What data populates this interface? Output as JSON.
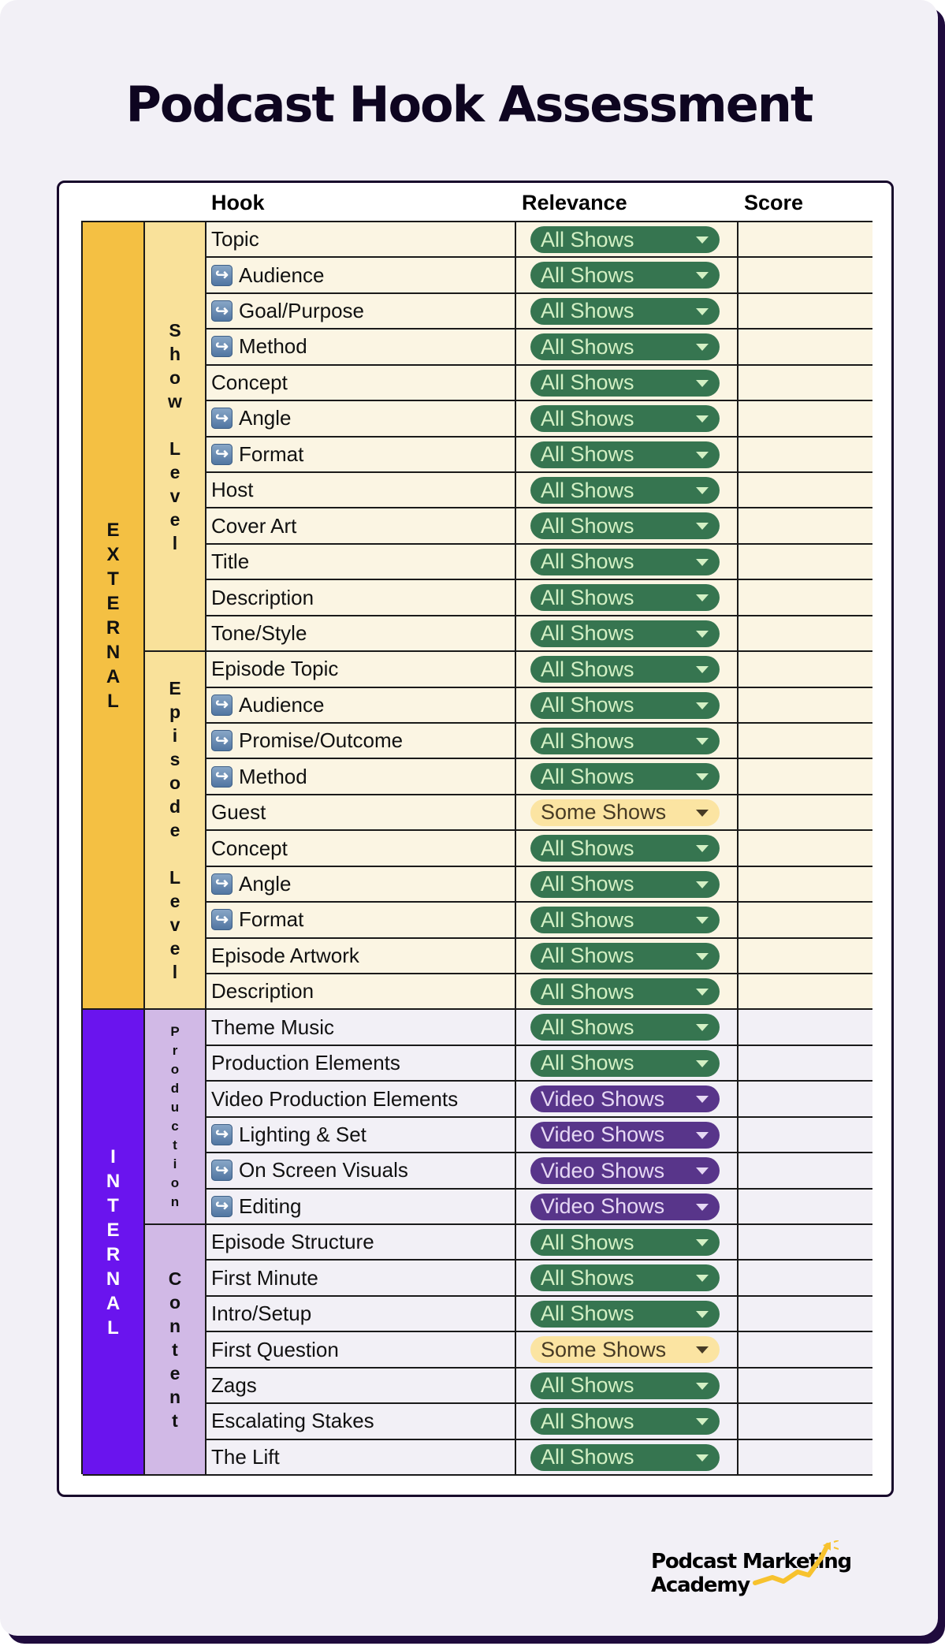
{
  "title": "Podcast Hook Assessment",
  "columns": {
    "hook": "Hook",
    "relevance": "Relevance",
    "score": "Score"
  },
  "relevance_colors": {
    "All Shows": "#367550",
    "Some Shows": "#fbe4a2",
    "Video Shows": "#58358a"
  },
  "groups": [
    {
      "label": "EXTERNAL",
      "color": "#f4c043",
      "subgroups": [
        {
          "label": "Show Level",
          "rows": [
            {
              "hook": "Topic",
              "sub": false,
              "relevance": "All Shows",
              "score": ""
            },
            {
              "hook": "Audience",
              "sub": true,
              "relevance": "All Shows",
              "score": ""
            },
            {
              "hook": "Goal/Purpose",
              "sub": true,
              "relevance": "All Shows",
              "score": ""
            },
            {
              "hook": "Method",
              "sub": true,
              "relevance": "All Shows",
              "score": ""
            },
            {
              "hook": "Concept",
              "sub": false,
              "relevance": "All Shows",
              "score": ""
            },
            {
              "hook": "Angle",
              "sub": true,
              "relevance": "All Shows",
              "score": ""
            },
            {
              "hook": "Format",
              "sub": true,
              "relevance": "All Shows",
              "score": ""
            },
            {
              "hook": "Host",
              "sub": false,
              "relevance": "All Shows",
              "score": ""
            },
            {
              "hook": "Cover Art",
              "sub": false,
              "relevance": "All Shows",
              "score": ""
            },
            {
              "hook": "Title",
              "sub": false,
              "relevance": "All Shows",
              "score": ""
            },
            {
              "hook": "Description",
              "sub": false,
              "relevance": "All Shows",
              "score": ""
            },
            {
              "hook": "Tone/Style",
              "sub": false,
              "relevance": "All Shows",
              "score": ""
            }
          ]
        },
        {
          "label": "Episode Level",
          "rows": [
            {
              "hook": "Episode Topic",
              "sub": false,
              "relevance": "All Shows",
              "score": ""
            },
            {
              "hook": "Audience",
              "sub": true,
              "relevance": "All Shows",
              "score": ""
            },
            {
              "hook": "Promise/Outcome",
              "sub": true,
              "relevance": "All Shows",
              "score": ""
            },
            {
              "hook": "Method",
              "sub": true,
              "relevance": "All Shows",
              "score": ""
            },
            {
              "hook": "Guest",
              "sub": false,
              "relevance": "Some Shows",
              "score": ""
            },
            {
              "hook": "Concept",
              "sub": false,
              "relevance": "All Shows",
              "score": ""
            },
            {
              "hook": "Angle",
              "sub": true,
              "relevance": "All Shows",
              "score": ""
            },
            {
              "hook": "Format",
              "sub": true,
              "relevance": "All Shows",
              "score": ""
            },
            {
              "hook": "Episode Artwork",
              "sub": false,
              "relevance": "All Shows",
              "score": ""
            },
            {
              "hook": "Description",
              "sub": false,
              "relevance": "All Shows",
              "score": ""
            }
          ]
        }
      ]
    },
    {
      "label": "INTERNAL",
      "color": "#6a14ee",
      "subgroups": [
        {
          "label": "Production",
          "rows": [
            {
              "hook": "Theme Music",
              "sub": false,
              "relevance": "All Shows",
              "score": ""
            },
            {
              "hook": "Production Elements",
              "sub": false,
              "relevance": "All Shows",
              "score": ""
            },
            {
              "hook": "Video Production Elements",
              "sub": false,
              "relevance": "Video Shows",
              "score": ""
            },
            {
              "hook": "Lighting & Set",
              "sub": true,
              "relevance": "Video Shows",
              "score": ""
            },
            {
              "hook": "On Screen Visuals",
              "sub": true,
              "relevance": "Video Shows",
              "score": ""
            },
            {
              "hook": "Editing",
              "sub": true,
              "relevance": "Video Shows",
              "score": ""
            }
          ]
        },
        {
          "label": "Content",
          "rows": [
            {
              "hook": "Episode Structure",
              "sub": false,
              "relevance": "All Shows",
              "score": ""
            },
            {
              "hook": "First Minute",
              "sub": false,
              "relevance": "All Shows",
              "score": ""
            },
            {
              "hook": "Intro/Setup",
              "sub": false,
              "relevance": "All Shows",
              "score": ""
            },
            {
              "hook": "First Question",
              "sub": false,
              "relevance": "Some Shows",
              "score": ""
            },
            {
              "hook": "Zags",
              "sub": false,
              "relevance": "All Shows",
              "score": ""
            },
            {
              "hook": "Escalating Stakes",
              "sub": false,
              "relevance": "All Shows",
              "score": ""
            },
            {
              "hook": "The Lift",
              "sub": false,
              "relevance": "All Shows",
              "score": ""
            }
          ]
        }
      ]
    }
  ],
  "sub_item_icon": "subitem-arrow-icon",
  "dropdown_icon": "dropdown-caret-icon",
  "logo": {
    "line1": "Podcast Marketing",
    "line2": "Academy",
    "icon": "rising-arrow-icon",
    "accent": "#f7c22e"
  }
}
